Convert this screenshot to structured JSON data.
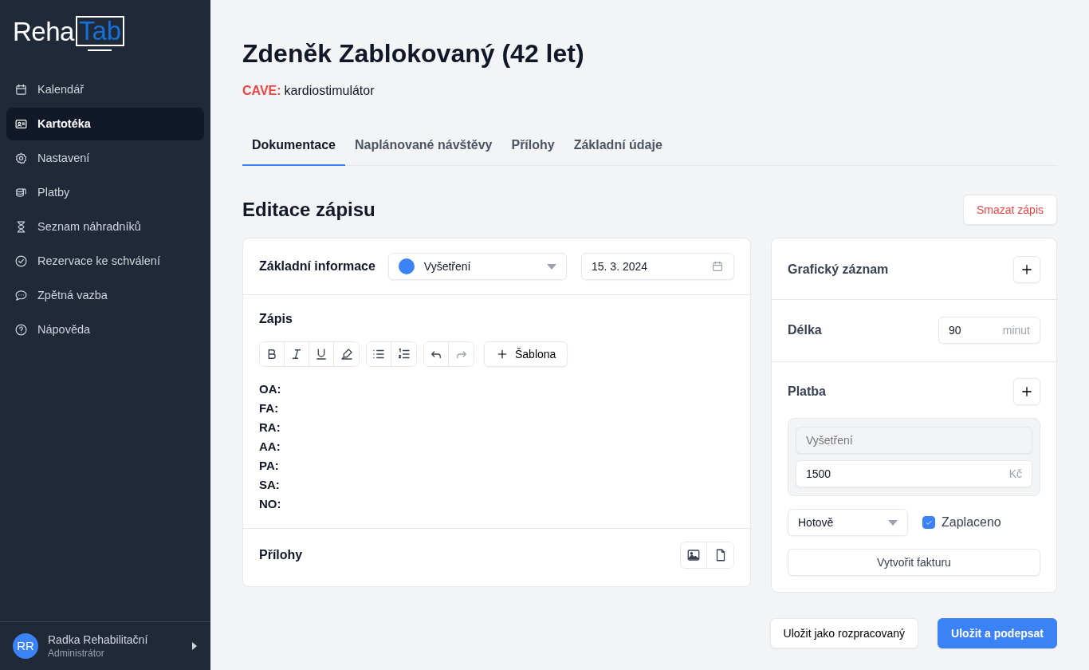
{
  "logo": {
    "part_1": "Reha",
    "part_2": "Tab"
  },
  "sidebar": {
    "items": [
      {
        "kind": "calendar",
        "label": "Kalendář",
        "selected": false
      },
      {
        "kind": "card",
        "label": "Kartotéka",
        "selected": true
      },
      {
        "kind": "gear",
        "label": "Nastavení",
        "selected": false
      },
      {
        "kind": "coins",
        "label": "Platby",
        "selected": false
      },
      {
        "kind": "hourglass",
        "label": "Seznam náhradníků",
        "selected": false
      },
      {
        "kind": "check",
        "label": "Rezervace ke schválení",
        "selected": false
      },
      {
        "kind": "chat",
        "label": "Zpětná vazba",
        "selected": false
      },
      {
        "kind": "help",
        "label": "Nápověda",
        "selected": false
      }
    ]
  },
  "user": {
    "initials": "RR",
    "name": "Radka Rehabilitační",
    "role": "Administrátor"
  },
  "patient": {
    "title": "Zdeněk Zablokovaný (42 let)",
    "cave_label": "CAVE:",
    "cave_text": "kardiostimulátor"
  },
  "tabs": [
    {
      "label": "Dokumentace",
      "selected": true
    },
    {
      "label": "Naplánované návštěvy",
      "selected": false
    },
    {
      "label": "Přílohy",
      "selected": false
    },
    {
      "label": "Základní údaje",
      "selected": false
    }
  ],
  "section": {
    "title": "Editace zápisu",
    "delete_button": "Smazat zápis"
  },
  "basic_info": {
    "label": "Základní informace",
    "visit_type": {
      "label": "Vyšetření",
      "color": "#3b82f6"
    },
    "date": "15. 3. 2024"
  },
  "note": {
    "label": "Zápis",
    "toolbar": [
      [
        {
          "kind": "bold",
          "disabled": false
        },
        {
          "kind": "italic",
          "disabled": false
        },
        {
          "kind": "underline",
          "disabled": false
        },
        {
          "kind": "highlight",
          "disabled": false
        }
      ],
      [
        {
          "kind": "bullets",
          "disabled": false
        },
        {
          "kind": "numbers",
          "disabled": false
        }
      ],
      [
        {
          "kind": "undo",
          "disabled": false
        },
        {
          "kind": "redo",
          "disabled": true
        }
      ]
    ],
    "template_button": "Šablona",
    "lines": [
      "OA:",
      "FA:",
      "RA:",
      "AA:",
      "PA:",
      "SA:",
      "NO:"
    ]
  },
  "attachments": {
    "label": "Přílohy"
  },
  "graphic_record": {
    "label": "Grafický záznam"
  },
  "duration": {
    "label": "Délka",
    "value": "90",
    "unit": "minut"
  },
  "payment": {
    "label": "Platba",
    "item_placeholder": "Vyšetření",
    "amount": "1500",
    "currency": "Kč",
    "method": "Hotově",
    "paid_label": "Zaplaceno",
    "paid_checked": true,
    "invoice_button": "Vytvořit fakturu"
  },
  "footer_buttons": [
    {
      "kind": "secondary",
      "label": "Uložit jako rozpracovaný"
    },
    {
      "kind": "primary",
      "label": "Uložit a podepsat"
    }
  ]
}
